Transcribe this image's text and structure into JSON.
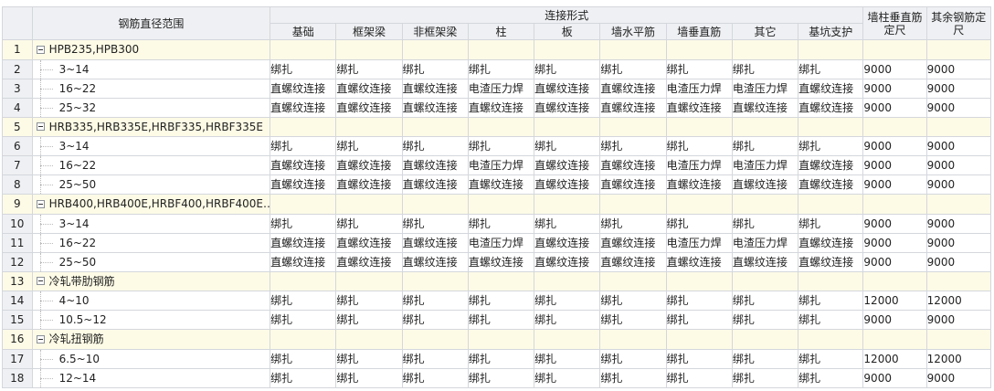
{
  "header": {
    "range_label": "钢筋直径范围",
    "group_label": "连接形式",
    "columns": [
      "基础",
      "框架梁",
      "非框架梁",
      "柱",
      "板",
      "墙水平筋",
      "墙垂直筋",
      "其它",
      "基坑支护"
    ],
    "wall_length_label": "墙柱垂直筋定尺",
    "other_length_label": "其余钢筋定尺"
  },
  "rows": [
    {
      "num": "1",
      "type": "group",
      "name": "HPB235,HPB300"
    },
    {
      "num": "2",
      "type": "child",
      "name": "3~14",
      "cells": [
        "绑扎",
        "绑扎",
        "绑扎",
        "绑扎",
        "绑扎",
        "绑扎",
        "绑扎",
        "绑扎",
        "绑扎"
      ],
      "wall": "9000",
      "other": "9000"
    },
    {
      "num": "3",
      "type": "child",
      "name": "16~22",
      "cells": [
        "直螺纹连接",
        "直螺纹连接",
        "直螺纹连接",
        "电渣压力焊",
        "直螺纹连接",
        "直螺纹连接",
        "电渣压力焊",
        "电渣压力焊",
        "直螺纹连接"
      ],
      "wall": "9000",
      "other": "9000"
    },
    {
      "num": "4",
      "type": "child",
      "name": "25~32",
      "cells": [
        "直螺纹连接",
        "直螺纹连接",
        "直螺纹连接",
        "直螺纹连接",
        "直螺纹连接",
        "直螺纹连接",
        "直螺纹连接",
        "直螺纹连接",
        "直螺纹连接"
      ],
      "wall": "9000",
      "other": "9000"
    },
    {
      "num": "5",
      "type": "group",
      "name": "HRB335,HRB335E,HRBF335,HRBF335E"
    },
    {
      "num": "6",
      "type": "child",
      "name": "3~14",
      "cells": [
        "绑扎",
        "绑扎",
        "绑扎",
        "绑扎",
        "绑扎",
        "绑扎",
        "绑扎",
        "绑扎",
        "绑扎"
      ],
      "wall": "9000",
      "other": "9000"
    },
    {
      "num": "7",
      "type": "child",
      "name": "16~22",
      "cells": [
        "直螺纹连接",
        "直螺纹连接",
        "直螺纹连接",
        "电渣压力焊",
        "直螺纹连接",
        "直螺纹连接",
        "电渣压力焊",
        "电渣压力焊",
        "直螺纹连接"
      ],
      "wall": "9000",
      "other": "9000"
    },
    {
      "num": "8",
      "type": "child",
      "name": "25~50",
      "cells": [
        "直螺纹连接",
        "直螺纹连接",
        "直螺纹连接",
        "直螺纹连接",
        "直螺纹连接",
        "直螺纹连接",
        "直螺纹连接",
        "直螺纹连接",
        "直螺纹连接"
      ],
      "wall": "9000",
      "other": "9000"
    },
    {
      "num": "9",
      "type": "group",
      "name": "HRB400,HRB400E,HRBF400,HRBF400E…"
    },
    {
      "num": "10",
      "type": "child",
      "name": "3~14",
      "cells": [
        "绑扎",
        "绑扎",
        "绑扎",
        "绑扎",
        "绑扎",
        "绑扎",
        "绑扎",
        "绑扎",
        "绑扎"
      ],
      "wall": "9000",
      "other": "9000"
    },
    {
      "num": "11",
      "type": "child",
      "name": "16~22",
      "cells": [
        "直螺纹连接",
        "直螺纹连接",
        "直螺纹连接",
        "电渣压力焊",
        "直螺纹连接",
        "直螺纹连接",
        "电渣压力焊",
        "电渣压力焊",
        "直螺纹连接"
      ],
      "wall": "9000",
      "other": "9000"
    },
    {
      "num": "12",
      "type": "child",
      "name": "25~50",
      "cells": [
        "直螺纹连接",
        "直螺纹连接",
        "直螺纹连接",
        "直螺纹连接",
        "直螺纹连接",
        "直螺纹连接",
        "直螺纹连接",
        "直螺纹连接",
        "直螺纹连接"
      ],
      "wall": "9000",
      "other": "9000"
    },
    {
      "num": "13",
      "type": "group",
      "name": "冷轧带肋钢筋"
    },
    {
      "num": "14",
      "type": "child",
      "name": "4~10",
      "cells": [
        "绑扎",
        "绑扎",
        "绑扎",
        "绑扎",
        "绑扎",
        "绑扎",
        "绑扎",
        "绑扎",
        "绑扎"
      ],
      "wall": "12000",
      "other": "12000"
    },
    {
      "num": "15",
      "type": "child",
      "name": "10.5~12",
      "cells": [
        "绑扎",
        "绑扎",
        "绑扎",
        "绑扎",
        "绑扎",
        "绑扎",
        "绑扎",
        "绑扎",
        "绑扎"
      ],
      "wall": "9000",
      "other": "9000"
    },
    {
      "num": "16",
      "type": "group",
      "name": "冷轧扭钢筋"
    },
    {
      "num": "17",
      "type": "child",
      "name": "6.5~10",
      "cells": [
        "绑扎",
        "绑扎",
        "绑扎",
        "绑扎",
        "绑扎",
        "绑扎",
        "绑扎",
        "绑扎",
        "绑扎"
      ],
      "wall": "12000",
      "other": "12000"
    },
    {
      "num": "18",
      "type": "child",
      "name": "12~14",
      "cells": [
        "绑扎",
        "绑扎",
        "绑扎",
        "绑扎",
        "绑扎",
        "绑扎",
        "绑扎",
        "绑扎",
        "绑扎"
      ],
      "wall": "9000",
      "other": "9000"
    }
  ]
}
